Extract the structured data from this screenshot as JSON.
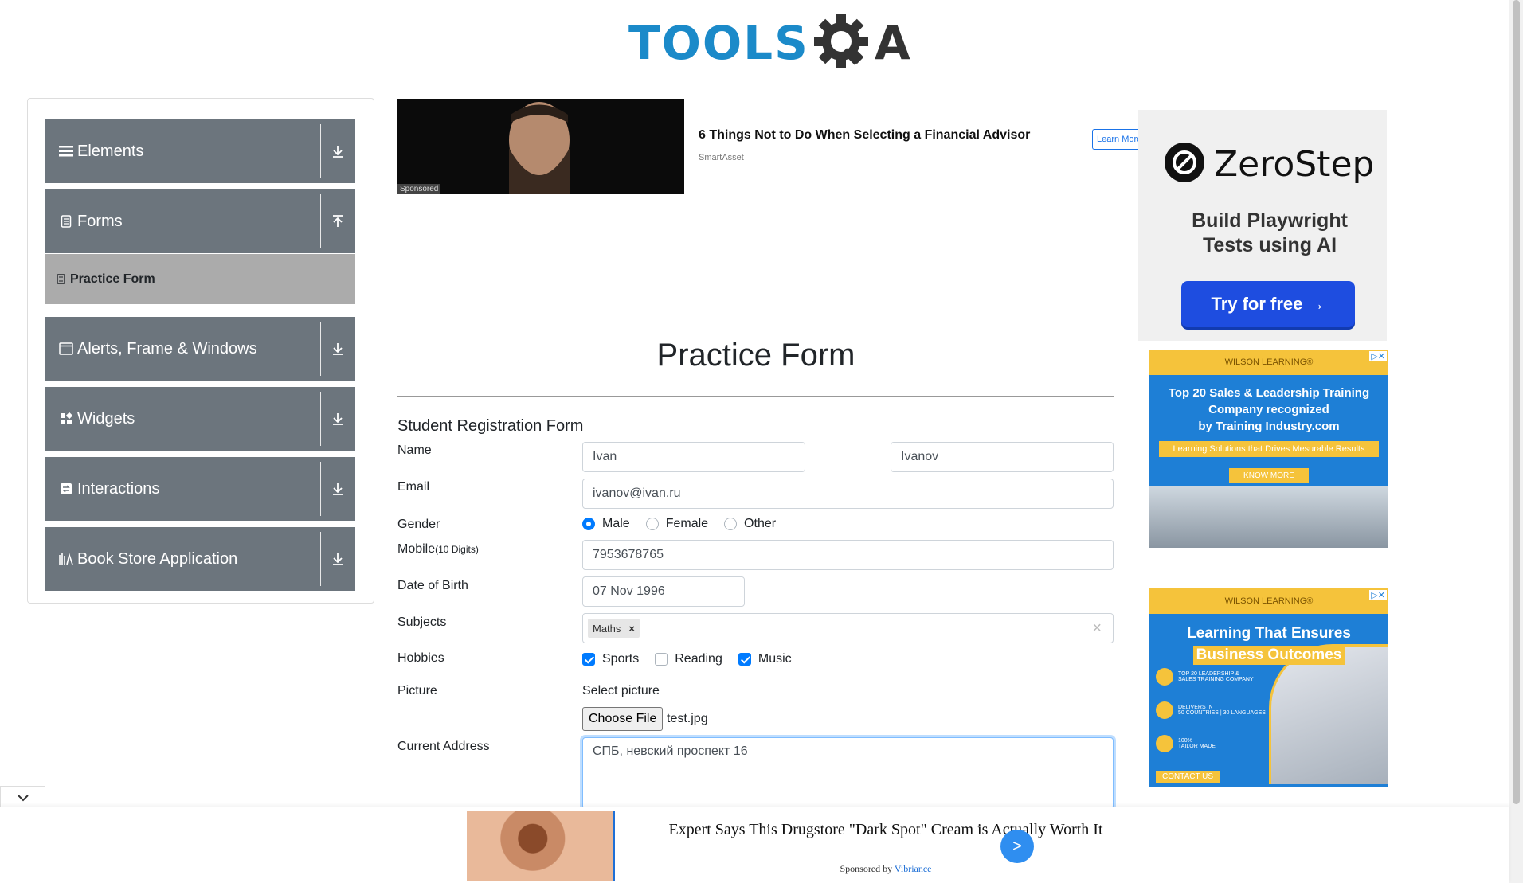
{
  "logo": {
    "text_left": "TOOLS",
    "text_right": "A"
  },
  "sidebar": {
    "groups": [
      {
        "label": "Elements",
        "icon": "list-icon",
        "arrow": "download-arrow-icon"
      },
      {
        "label": "Forms",
        "icon": "document-icon",
        "arrow": "upload-arrow-icon"
      },
      {
        "label": "Alerts, Frame & Windows",
        "icon": "window-icon",
        "arrow": "download-arrow-icon"
      },
      {
        "label": "Widgets",
        "icon": "widgets-icon",
        "arrow": "download-arrow-icon"
      },
      {
        "label": "Interactions",
        "icon": "interactions-icon",
        "arrow": "download-arrow-icon"
      },
      {
        "label": "Book Store Application",
        "icon": "books-icon",
        "arrow": "download-arrow-icon"
      }
    ],
    "active_item": "Practice Form"
  },
  "ad_top": {
    "sponsored": "Sponsored",
    "title": "6 Things Not to Do When Selecting a Financial Advisor",
    "source": "SmartAsset",
    "button": "Learn More"
  },
  "page": {
    "title": "Practice Form",
    "form_title": "Student Registration Form"
  },
  "form": {
    "name_label": "Name",
    "first_name": "Ivan",
    "last_name": "Ivanov",
    "email_label": "Email",
    "email": "ivanov@ivan.ru",
    "gender_label": "Gender",
    "gender_options": [
      "Male",
      "Female",
      "Other"
    ],
    "gender_selected": "Male",
    "mobile_label": "Mobile",
    "mobile_hint": "(10 Digits)",
    "mobile": "7953678765",
    "dob_label": "Date of Birth",
    "dob": "07 Nov 1996",
    "subjects_label": "Subjects",
    "subjects": [
      "Maths"
    ],
    "subjects_clear": "×",
    "chip_remove": "×",
    "hobbies_label": "Hobbies",
    "hobbies": [
      {
        "label": "Sports",
        "checked": true
      },
      {
        "label": "Reading",
        "checked": false
      },
      {
        "label": "Music",
        "checked": true
      }
    ],
    "picture_label": "Picture",
    "picture_prompt": "Select picture",
    "choose_file": "Choose File",
    "file_name": "test.jpg",
    "address_label": "Current Address",
    "address": "СПБ, невский проспект 16"
  },
  "right_ads": {
    "zerostep": {
      "brand": "ZeroStep",
      "tagline_1": "Build Playwright",
      "tagline_2": "Tests using AI",
      "button": "Try for free →"
    },
    "wilson1": {
      "brand": "WILSON LEARNING®",
      "headline_1": "Top 20 Sales & Leadership Training",
      "headline_2": "Company recognized",
      "headline_3": "by Training Industry.com",
      "banner": "Learning Solutions that Drives Mesurable Results",
      "button": "KNOW MORE"
    },
    "wilson2": {
      "brand": "WILSON LEARNING®",
      "headline_1": "Learning That Ensures",
      "headline_2": "Business Outcomes",
      "bullet_1a": "TOP 20 LEADERSHIP &",
      "bullet_1b": "SALES TRAINING COMPANY",
      "bullet_2a": "DELIVERS IN",
      "bullet_2b": "50 COUNTRIES | 30 LANGUAGES",
      "bullet_3a": "100%",
      "bullet_3b": "TAILOR MADE",
      "button": "CONTACT US"
    },
    "ad_badge": "▷✕"
  },
  "bottom_ad": {
    "title": "Expert Says This Drugstore \"Dark Spot\" Cream is Actually Worth It",
    "sponsored_prefix": "Sponsored by",
    "sponsor": "Vibriance",
    "go": ">"
  },
  "colors": {
    "sidebar_header": "#6c757d",
    "active_item": "#ababab",
    "accent": "#007bff",
    "logo_blue": "#1b8ac9"
  }
}
